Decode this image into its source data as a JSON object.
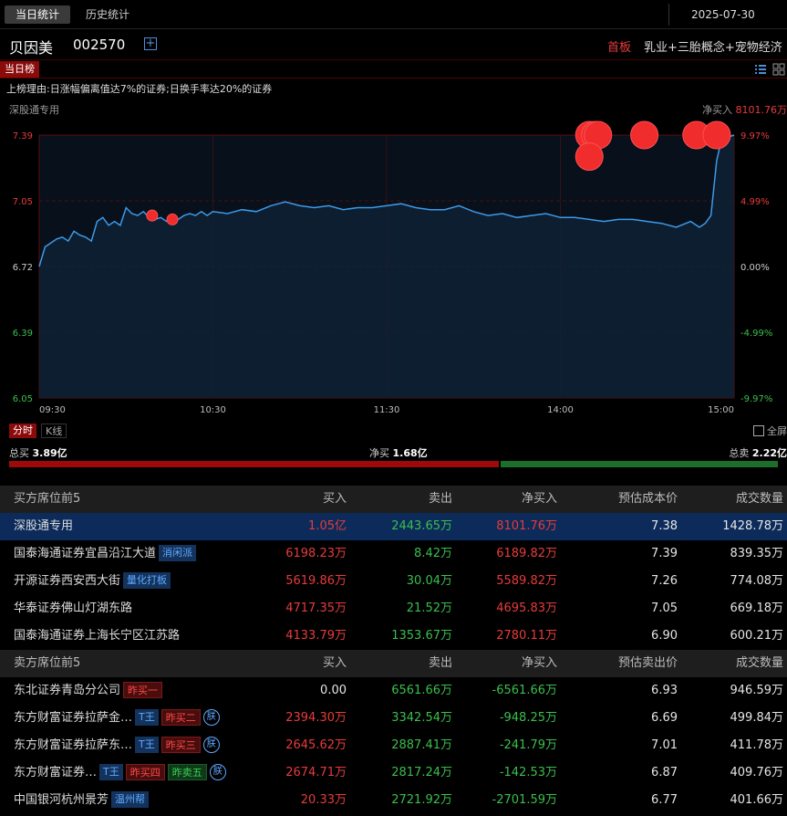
{
  "tabs": [
    {
      "label": "当日统计",
      "active": true
    },
    {
      "label": "历史统计",
      "active": false
    }
  ],
  "date": "2025-07-30",
  "stock": {
    "name": "贝因美",
    "code": "002570",
    "plus": "+",
    "board": "首板",
    "concepts": "乳业+三胎概念+宠物经济"
  },
  "list_tag": "当日榜",
  "reason": "上榜理由:日涨幅偏离值达7%的证券;日换手率达20%的证券",
  "chart": {
    "seat_label": "深股通专用",
    "net_label": "净买入",
    "net_value": "8101.76万",
    "line_color": "#3d9ae8",
    "red": "#e83b3b",
    "green": "#3bbf4d"
  },
  "chart_data": {
    "type": "line",
    "ylim": [
      6.05,
      7.39
    ],
    "y_ticks_left": [
      "7.39",
      "7.05",
      "6.72",
      "6.39",
      "6.05"
    ],
    "y_ticks_right": [
      "9.97%",
      "4.99%",
      "0.00%",
      "-4.99%",
      "-9.97%"
    ],
    "x_ticks": [
      "09:30",
      "10:30",
      "11:30",
      "14:00",
      "15:00"
    ],
    "series": [
      {
        "x": [
          0,
          2,
          4,
          6,
          8,
          10,
          12,
          14,
          16,
          18,
          20,
          22,
          24,
          26,
          28,
          30,
          32,
          34,
          36,
          38,
          40,
          42,
          44,
          46,
          48,
          50,
          52,
          54,
          56,
          58,
          60,
          65,
          70,
          75,
          80,
          85,
          90,
          95,
          100,
          105,
          110,
          115,
          120,
          125,
          130,
          135,
          140,
          145,
          150,
          155,
          160,
          165,
          170,
          175,
          180,
          185,
          190,
          195,
          200,
          205,
          210,
          215,
          220,
          225,
          228,
          230,
          232,
          234,
          236,
          238,
          240
        ],
        "y": [
          6.72,
          6.82,
          6.84,
          6.86,
          6.87,
          6.85,
          6.9,
          6.88,
          6.87,
          6.85,
          6.95,
          6.97,
          6.93,
          6.95,
          6.93,
          7.02,
          6.99,
          6.98,
          7.0,
          6.97,
          6.96,
          6.97,
          6.95,
          6.97,
          6.96,
          6.98,
          6.99,
          6.98,
          7.0,
          6.98,
          7.0,
          6.99,
          7.01,
          7.0,
          7.03,
          7.05,
          7.03,
          7.02,
          7.03,
          7.01,
          7.02,
          7.02,
          7.03,
          7.04,
          7.02,
          7.01,
          7.01,
          7.03,
          7.0,
          6.98,
          6.99,
          6.97,
          6.98,
          6.99,
          6.97,
          6.97,
          6.96,
          6.95,
          6.96,
          6.96,
          6.95,
          6.94,
          6.92,
          6.95,
          6.92,
          6.94,
          6.98,
          7.26,
          7.39,
          7.38,
          7.39
        ]
      }
    ],
    "trade_markers": [
      {
        "x": 39,
        "y": 6.98,
        "size": "small"
      },
      {
        "x": 46,
        "y": 6.96,
        "size": "small"
      },
      {
        "x": 190,
        "y": 7.39,
        "size": "large"
      },
      {
        "x": 192,
        "y": 7.39,
        "size": "large"
      },
      {
        "x": 193,
        "y": 7.39,
        "size": "large"
      },
      {
        "x": 190,
        "y": 7.28,
        "size": "large"
      },
      {
        "x": 209,
        "y": 7.39,
        "size": "large"
      },
      {
        "x": 227,
        "y": 7.39,
        "size": "large"
      },
      {
        "x": 234,
        "y": 7.39,
        "size": "large"
      }
    ]
  },
  "modes": {
    "active": "分时",
    "other": "K线"
  },
  "fullscreen": "全屏",
  "flow": {
    "total_buy_label": "总买",
    "total_buy": "3.89亿",
    "net_buy_label": "净买",
    "net_buy": "1.68亿",
    "total_sell_label": "总卖",
    "total_sell": "2.22亿",
    "buy_ratio": 0.637
  },
  "buy_table": {
    "headers": [
      "买方席位前5",
      "买入",
      "卖出",
      "净买入",
      "预估成本价",
      "成交数量"
    ],
    "rows": [
      {
        "name": "深股通专用",
        "tags": [],
        "buy": "1.05亿",
        "sell": "2443.65万",
        "net": "8101.76万",
        "price": "7.38",
        "volume": "1428.78万",
        "highlight": true
      },
      {
        "name": "国泰海通证券宜昌沿江大道",
        "tags": [
          {
            "text": "消闲派",
            "style": "blue"
          }
        ],
        "buy": "6198.23万",
        "sell": "8.42万",
        "net": "6189.82万",
        "price": "7.39",
        "volume": "839.35万"
      },
      {
        "name": "开源证券西安西大街",
        "tags": [
          {
            "text": "量化打板",
            "style": "blue"
          }
        ],
        "buy": "5619.86万",
        "sell": "30.04万",
        "net": "5589.82万",
        "price": "7.26",
        "volume": "774.08万"
      },
      {
        "name": "华泰证券佛山灯湖东路",
        "tags": [],
        "buy": "4717.35万",
        "sell": "21.52万",
        "net": "4695.83万",
        "price": "7.05",
        "volume": "669.18万"
      },
      {
        "name": "国泰海通证券上海长宁区江苏路",
        "tags": [],
        "buy": "4133.79万",
        "sell": "1353.67万",
        "net": "2780.11万",
        "price": "6.90",
        "volume": "600.21万"
      }
    ]
  },
  "sell_table": {
    "headers": [
      "卖方席位前5",
      "买入",
      "卖出",
      "净买入",
      "预估卖出价",
      "成交数量"
    ],
    "rows": [
      {
        "name": "东北证券青岛分公司",
        "tags": [
          {
            "text": "昨买一",
            "style": "red"
          }
        ],
        "buy": "0.00",
        "sell": "6561.66万",
        "net": "-6561.66万",
        "price": "6.93",
        "volume": "946.59万",
        "buy_white": true
      },
      {
        "name": "东方财富证券拉萨金…",
        "tags": [
          {
            "text": "T王",
            "style": "blue"
          },
          {
            "text": "昨买二",
            "style": "red"
          },
          {
            "text": "朕",
            "style": "circle"
          }
        ],
        "buy": "2394.30万",
        "sell": "3342.54万",
        "net": "-948.25万",
        "price": "6.69",
        "volume": "499.84万"
      },
      {
        "name": "东方财富证券拉萨东…",
        "tags": [
          {
            "text": "T王",
            "style": "blue"
          },
          {
            "text": "昨买三",
            "style": "red"
          },
          {
            "text": "朕",
            "style": "circle"
          }
        ],
        "buy": "2645.62万",
        "sell": "2887.41万",
        "net": "-241.79万",
        "price": "7.01",
        "volume": "411.78万"
      },
      {
        "name": "东方财富证券…",
        "tags": [
          {
            "text": "T王",
            "style": "blue"
          },
          {
            "text": "昨买四",
            "style": "red"
          },
          {
            "text": "昨卖五",
            "style": "green"
          },
          {
            "text": "朕",
            "style": "circle"
          }
        ],
        "buy": "2674.71万",
        "sell": "2817.24万",
        "net": "-142.53万",
        "price": "6.87",
        "volume": "409.76万"
      },
      {
        "name": "中国银河杭州景芳",
        "tags": [
          {
            "text": "温州帮",
            "style": "blue"
          }
        ],
        "buy": "20.33万",
        "sell": "2721.92万",
        "net": "-2701.59万",
        "price": "6.77",
        "volume": "401.66万"
      }
    ]
  }
}
